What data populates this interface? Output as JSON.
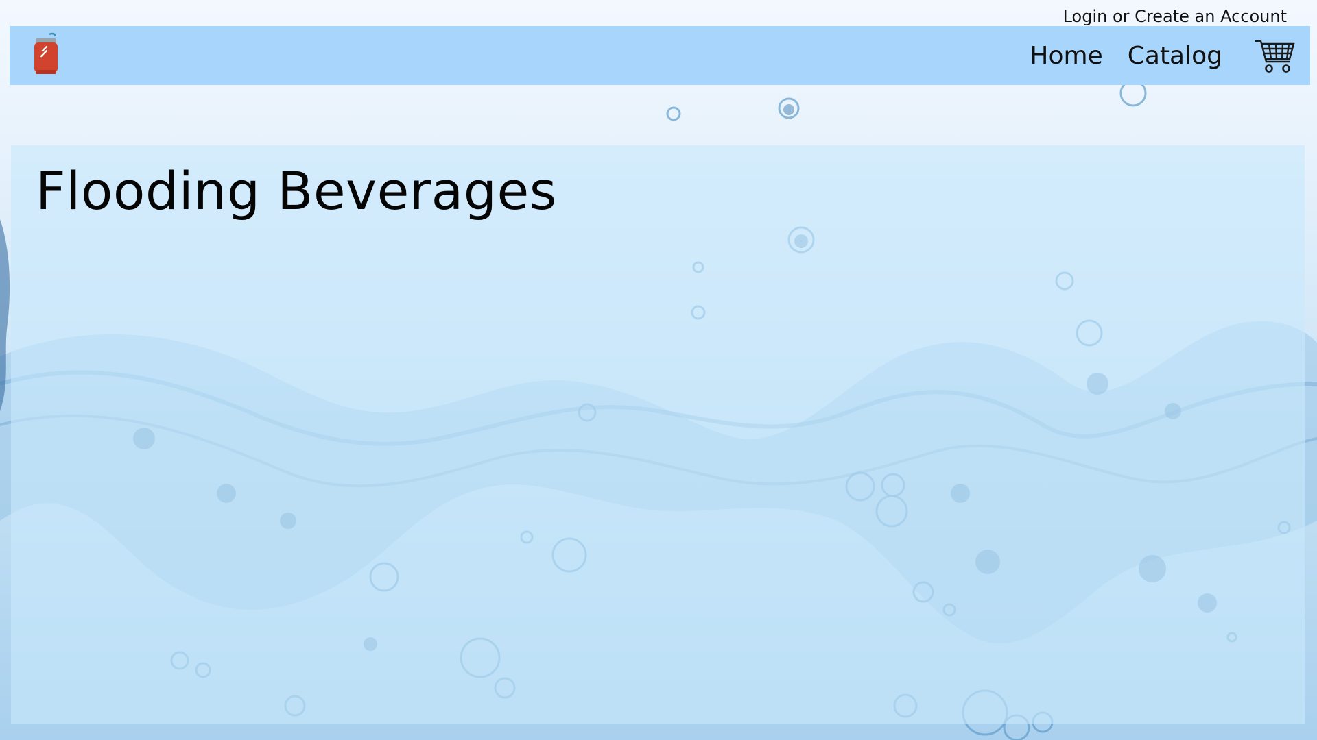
{
  "header": {
    "account_link": "Login or Create an Account"
  },
  "navbar": {
    "logo_icon": "soda-can-icon",
    "links": [
      {
        "label": "Home"
      },
      {
        "label": "Catalog"
      }
    ],
    "cart_icon": "shopping-cart-icon",
    "background_color": "#a8d5fb"
  },
  "hero": {
    "title": "Flooding Beverages",
    "background": "water-splash-image"
  }
}
